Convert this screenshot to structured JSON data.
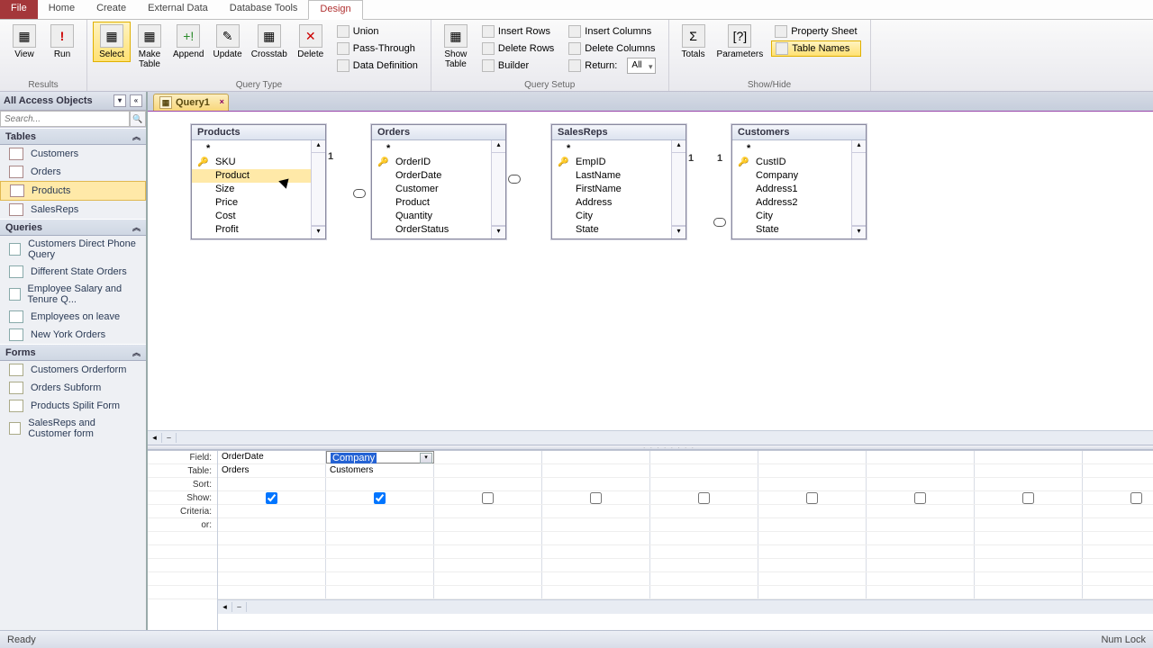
{
  "ribbon": {
    "tabs": [
      "File",
      "Home",
      "Create",
      "External Data",
      "Database Tools",
      "Design"
    ],
    "active_tab": "Design",
    "groups": {
      "results": {
        "label": "Results",
        "view": "View",
        "run": "Run"
      },
      "query_type": {
        "label": "Query Type",
        "select": "Select",
        "make_table": "Make\nTable",
        "append": "Append",
        "update": "Update",
        "crosstab": "Crosstab",
        "delete": "Delete",
        "union": "Union",
        "pass_through": "Pass-Through",
        "data_definition": "Data Definition"
      },
      "query_setup": {
        "label": "Query Setup",
        "show_table": "Show\nTable",
        "insert_rows": "Insert Rows",
        "delete_rows": "Delete Rows",
        "builder": "Builder",
        "insert_columns": "Insert Columns",
        "delete_columns": "Delete Columns",
        "return": "Return:",
        "return_value": "All"
      },
      "show_hide": {
        "label": "Show/Hide",
        "totals": "Totals",
        "parameters": "Parameters",
        "property_sheet": "Property Sheet",
        "table_names": "Table Names"
      }
    }
  },
  "navpane": {
    "title": "All Access Objects",
    "search_placeholder": "Search...",
    "sections": {
      "tables": {
        "label": "Tables",
        "items": [
          "Customers",
          "Orders",
          "Products",
          "SalesReps"
        ],
        "selected": "Products"
      },
      "queries": {
        "label": "Queries",
        "items": [
          "Customers Direct Phone Query",
          "Different State Orders",
          "Employee Salary and Tenure Q...",
          "Employees on leave",
          "New York Orders"
        ]
      },
      "forms": {
        "label": "Forms",
        "items": [
          "Customers Orderform",
          "Orders Subform",
          "Products Spilit Form",
          "SalesReps and Customer form"
        ]
      }
    }
  },
  "doc_tab": {
    "name": "Query1"
  },
  "tables": {
    "products": {
      "title": "Products",
      "fields": [
        "*",
        "SKU",
        "Product",
        "Size",
        "Price",
        "Cost",
        "Profit"
      ],
      "key": "SKU",
      "highlighted": "Product"
    },
    "orders": {
      "title": "Orders",
      "fields": [
        "*",
        "OrderID",
        "OrderDate",
        "Customer",
        "Product",
        "Quantity",
        "OrderStatus"
      ],
      "key": "OrderID"
    },
    "salesreps": {
      "title": "SalesReps",
      "fields": [
        "*",
        "EmpID",
        "LastName",
        "FirstName",
        "Address",
        "City",
        "State"
      ],
      "key": "EmpID"
    },
    "customers": {
      "title": "Customers",
      "fields": [
        "*",
        "CustID",
        "Company",
        "Address1",
        "Address2",
        "City",
        "State"
      ],
      "key": "CustID"
    }
  },
  "joins": {
    "products_orders": {
      "left": "1",
      "right": "∞"
    },
    "orders_salesreps": {
      "left": "∞",
      "right": ""
    },
    "salesreps_customers": {
      "left": "1",
      "right": "1",
      "extra": "∞"
    }
  },
  "qbe": {
    "row_labels": [
      "Field:",
      "Table:",
      "Sort:",
      "Show:",
      "Criteria:",
      "or:"
    ],
    "cols": [
      {
        "field": "OrderDate",
        "table": "Orders",
        "show": true
      },
      {
        "field": "Company",
        "table": "Customers",
        "show": true,
        "editing": true
      }
    ],
    "blank_show": false
  },
  "status": {
    "left": "Ready",
    "right": "Num Lock"
  }
}
